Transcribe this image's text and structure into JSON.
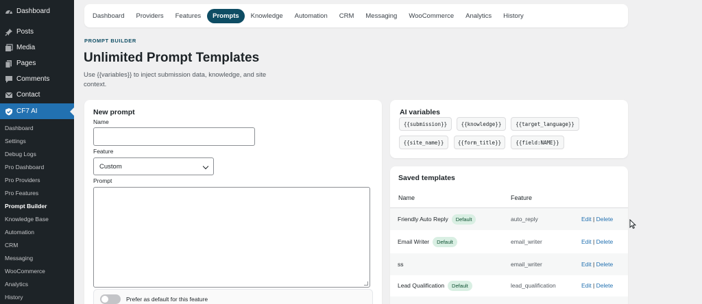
{
  "sidebar": {
    "menu": [
      {
        "label": "Dashboard",
        "icon": "dashboard-icon"
      },
      {
        "label": "Posts",
        "icon": "pin-icon"
      },
      {
        "label": "Media",
        "icon": "media-icon"
      },
      {
        "label": "Pages",
        "icon": "pages-icon"
      },
      {
        "label": "Comments",
        "icon": "comments-icon"
      },
      {
        "label": "Contact",
        "icon": "mail-icon"
      },
      {
        "label": "CF7 AI",
        "icon": "shield-icon"
      }
    ],
    "submenu": [
      "Dashboard",
      "Settings",
      "Debug Logs",
      "Pro Dashboard",
      "Pro Providers",
      "Pro Features",
      "Prompt Builder",
      "Knowledge Base",
      "Automation",
      "CRM",
      "Messaging",
      "WooCommerce",
      "Analytics",
      "History"
    ],
    "current_sub": "Prompt Builder"
  },
  "tabs": [
    "Dashboard",
    "Providers",
    "Features",
    "Prompts",
    "Knowledge",
    "Automation",
    "CRM",
    "Messaging",
    "WooCommerce",
    "Analytics",
    "History"
  ],
  "active_tab": "Prompts",
  "page": {
    "eyebrow": "PROMPT BUILDER",
    "title": "Unlimited Prompt Templates",
    "description": "Use {{variables}} to inject submission data, knowledge, and site context."
  },
  "new_prompt": {
    "title": "New prompt",
    "name_label": "Name",
    "name_value": "",
    "feature_label": "Feature",
    "feature_value": "Custom",
    "prompt_label": "Prompt",
    "prompt_value": "",
    "toggle_label": "Prefer as default for this feature",
    "toggle_on": false
  },
  "ai_variables": {
    "title": "AI variables",
    "chips": [
      "{{submission}}",
      "{{knowledge}}",
      "{{target_language}}",
      "{{site_name}}",
      "{{form_title}}",
      "{{field:NAME}}"
    ]
  },
  "saved_templates": {
    "title": "Saved templates",
    "columns": [
      "Name",
      "Feature"
    ],
    "rows": [
      {
        "name": "Friendly Auto Reply",
        "default": true,
        "feature": "auto_reply"
      },
      {
        "name": "Email Writer",
        "default": true,
        "feature": "email_writer"
      },
      {
        "name": "ss",
        "default": false,
        "feature": "email_writer"
      },
      {
        "name": "Lead Qualification",
        "default": true,
        "feature": "lead_qualification"
      }
    ],
    "badge_label": "Default",
    "edit_label": "Edit",
    "delete_label": "Delete",
    "separator": "|"
  },
  "colors": {
    "sidebar_bg": "#1d2327",
    "sidebar_active": "#2271b1",
    "tab_active": "#0e4d64",
    "link": "#2271b1",
    "badge_bg": "#d9efe3",
    "badge_text": "#0f5132"
  }
}
